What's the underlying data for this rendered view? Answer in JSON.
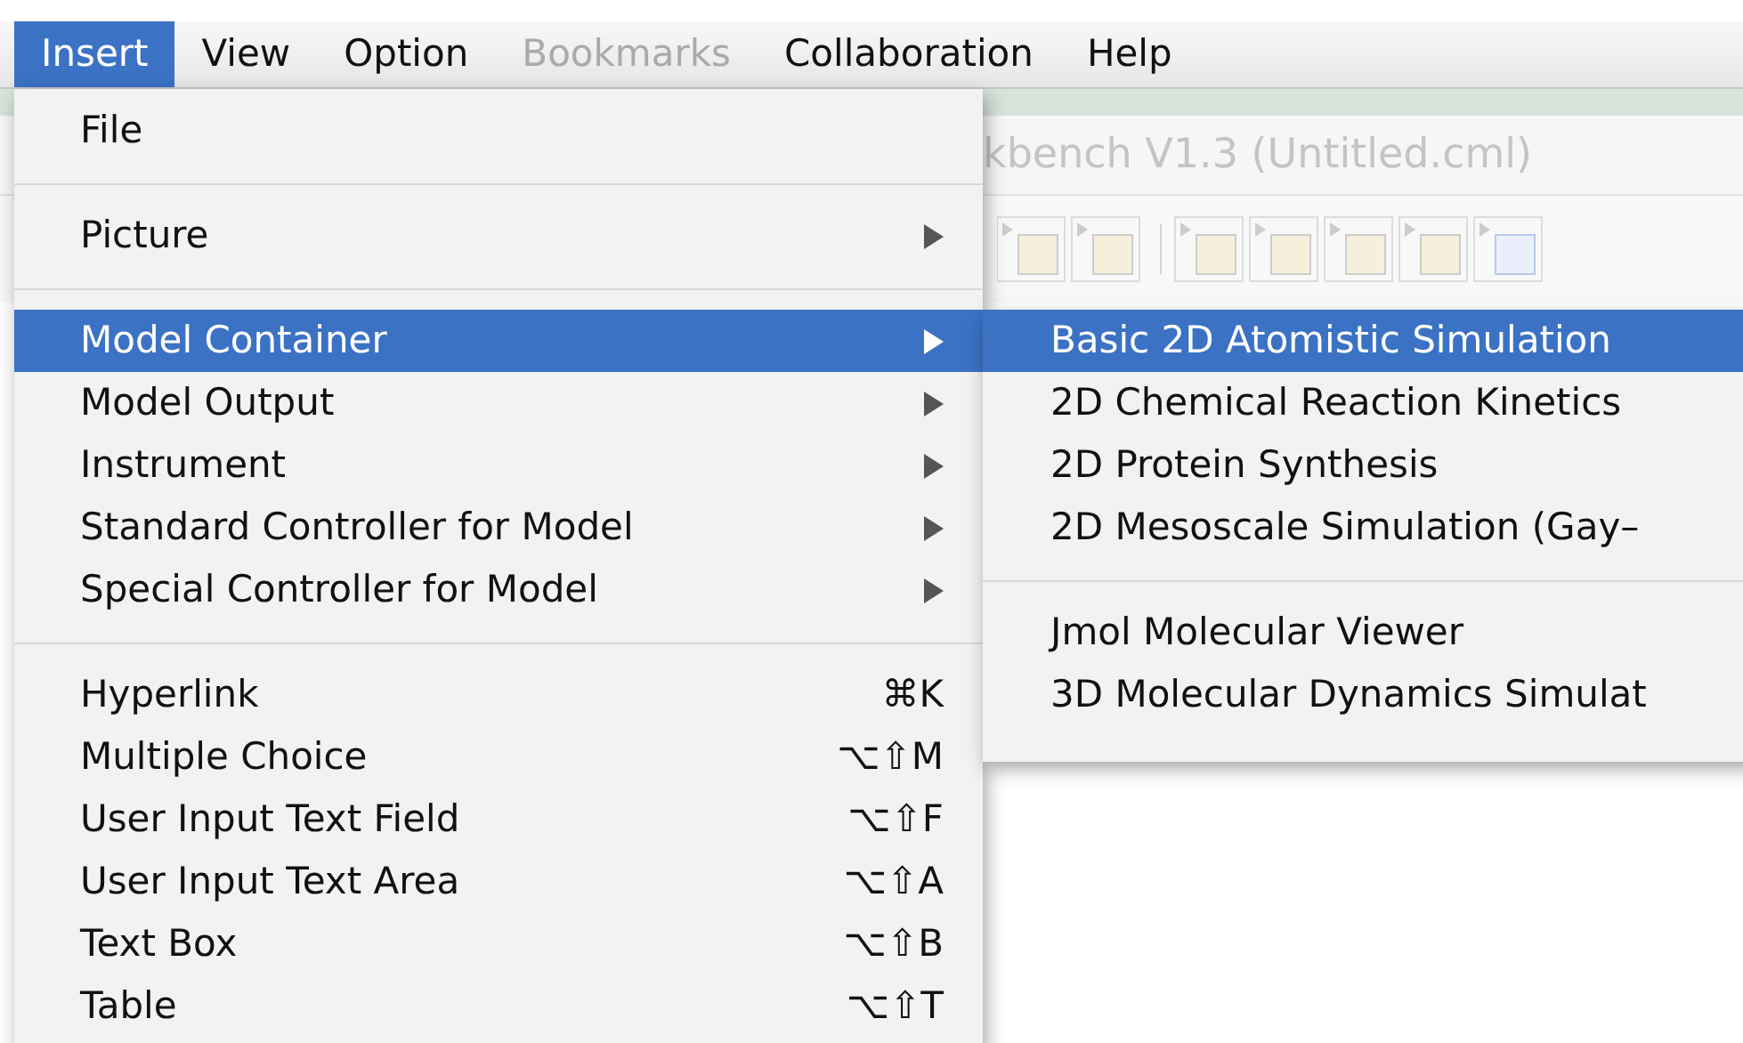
{
  "menubar": [
    {
      "label": "Insert",
      "selected": true,
      "disabled": false
    },
    {
      "label": "View",
      "selected": false,
      "disabled": false
    },
    {
      "label": "Option",
      "selected": false,
      "disabled": false
    },
    {
      "label": "Bookmarks",
      "selected": false,
      "disabled": true
    },
    {
      "label": "Collaboration",
      "selected": false,
      "disabled": false
    },
    {
      "label": "Help",
      "selected": false,
      "disabled": false
    }
  ],
  "background_window": {
    "title": "kbench V1.3 (Untitled.cml)"
  },
  "menu": {
    "items": [
      {
        "kind": "item",
        "label": "File",
        "submenu": false,
        "selected": false
      },
      {
        "kind": "separator"
      },
      {
        "kind": "item",
        "label": "Picture",
        "submenu": true,
        "selected": false
      },
      {
        "kind": "separator"
      },
      {
        "kind": "item",
        "label": "Model Container",
        "submenu": true,
        "selected": true
      },
      {
        "kind": "item",
        "label": "Model Output",
        "submenu": true,
        "selected": false
      },
      {
        "kind": "item",
        "label": "Instrument",
        "submenu": true,
        "selected": false
      },
      {
        "kind": "item",
        "label": "Standard Controller for Model",
        "submenu": true,
        "selected": false
      },
      {
        "kind": "item",
        "label": "Special Controller for Model",
        "submenu": true,
        "selected": false
      },
      {
        "kind": "separator"
      },
      {
        "kind": "item",
        "label": "Hyperlink",
        "submenu": false,
        "shortcut": "⌘K",
        "selected": false
      },
      {
        "kind": "item",
        "label": "Multiple Choice",
        "submenu": false,
        "shortcut": "⌥⇧M",
        "selected": false
      },
      {
        "kind": "item",
        "label": "User Input Text Field",
        "submenu": false,
        "shortcut": "⌥⇧F",
        "selected": false
      },
      {
        "kind": "item",
        "label": "User Input Text Area",
        "submenu": false,
        "shortcut": "⌥⇧A",
        "selected": false
      },
      {
        "kind": "item",
        "label": "Text Box",
        "submenu": false,
        "shortcut": "⌥⇧B",
        "selected": false
      },
      {
        "kind": "item",
        "label": "Table",
        "submenu": false,
        "shortcut": "⌥⇧T",
        "selected": false
      }
    ]
  },
  "submenu": {
    "items": [
      {
        "kind": "item",
        "label": "Basic 2D Atomistic Simulation",
        "selected": true
      },
      {
        "kind": "item",
        "label": "2D Chemical Reaction Kinetics",
        "selected": false
      },
      {
        "kind": "item",
        "label": "2D Protein Synthesis",
        "selected": false
      },
      {
        "kind": "item",
        "label": "2D Mesoscale Simulation (Gay–",
        "selected": false
      },
      {
        "kind": "separator"
      },
      {
        "kind": "item",
        "label": "Jmol Molecular Viewer",
        "selected": false
      },
      {
        "kind": "item",
        "label": "3D Molecular Dynamics Simulat",
        "selected": false
      }
    ]
  }
}
